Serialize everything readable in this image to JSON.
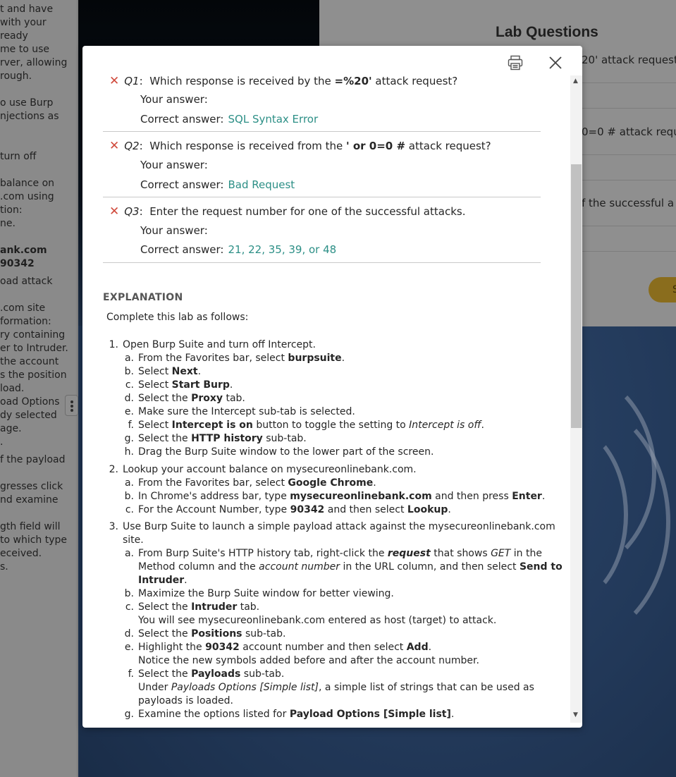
{
  "background": {
    "left_text_lines": [
      "t and have",
      "with your",
      "ready",
      "me to use",
      "rver, allowing",
      "rough.",
      "o use Burp",
      "njections as",
      "turn off",
      "balance on",
      ".com using",
      "tion:",
      "ne.",
      "ank.com",
      "90342",
      "oad attack",
      ".com site",
      "formation:",
      "ry containing",
      "er to Intruder.",
      "the account",
      "s the position",
      "load.",
      "oad Options",
      "dy selected",
      "age.",
      ".",
      "f the payload",
      "gresses click",
      "nd examine",
      "gth field will",
      "to which type",
      "eceived.",
      "s."
    ],
    "lab_panel": {
      "title": "Lab Questions",
      "q_snippets": [
        "20' attack request",
        "0=0 # attack requ",
        "f the successful a"
      ],
      "submit_label": "S"
    },
    "colors": {
      "desktop": "#233a5b",
      "submit": "#8a6d1d"
    }
  },
  "modal": {
    "questions": [
      {
        "marker": "✕",
        "id": "Q1",
        "text_pre": "Which response is received by the ",
        "text_bold": "=%20'",
        "text_post": " attack request?",
        "your_answer_label": "Your answer:",
        "your_answer": "",
        "correct_answer_label": "Correct answer:",
        "correct_answer": "SQL Syntax Error"
      },
      {
        "marker": "✕",
        "id": "Q2",
        "text_pre": "Which response is received from the ",
        "text_bold": "' or 0=0 #",
        "text_post": " attack request?",
        "your_answer_label": "Your answer:",
        "your_answer": "",
        "correct_answer_label": "Correct answer:",
        "correct_answer": "Bad Request"
      },
      {
        "marker": "✕",
        "id": "Q3",
        "text_pre": "Enter the request number for one of the successful attacks.",
        "text_bold": "",
        "text_post": "",
        "your_answer_label": "Your answer:",
        "your_answer": "",
        "correct_answer_label": "Correct answer:",
        "correct_answer": "21, 22, 35, 39, or 48"
      }
    ],
    "explanation": {
      "heading": "EXPLANATION",
      "intro": "Complete this lab as follows:",
      "step1": {
        "num": "1.",
        "text": "Open Burp Suite and turn off Intercept.",
        "a": "From the Favorites bar, select ",
        "a_b": "burpsuite",
        "a_e": ".",
        "b": "Select ",
        "b_b": "Next",
        "b_e": ".",
        "c": "Select ",
        "c_b": "Start Burp",
        "c_e": ".",
        "d": "Select the ",
        "d_b": "Proxy",
        "d_e": " tab.",
        "e": "Make sure the Intercept sub-tab is selected.",
        "f": "Select ",
        "f_b": "Intercept is on",
        "f_m": " button to toggle the setting to ",
        "f_i": "Intercept is off",
        "f_e": ".",
        "g": "Select the ",
        "g_b": "HTTP history",
        "g_e": " sub-tab.",
        "h": "Drag the Burp Suite window to the lower part of the screen."
      },
      "step2": {
        "num": "2.",
        "text": "Lookup your account balance on mysecureonlinebank.com.",
        "a": "From the Favorites bar, select ",
        "a_b": "Google Chrome",
        "a_e": ".",
        "b": "In Chrome's address bar, type ",
        "b_b": "mysecureonlinebank.com",
        "b_m": " and then press ",
        "b_b2": "Enter",
        "b_e": ".",
        "c": "For the Account Number, type ",
        "c_b": "90342",
        "c_m": " and then select ",
        "c_b2": "Lookup",
        "c_e": "."
      },
      "step3": {
        "num": "3.",
        "text_l1": "Use Burp Suite to launch a simple payload attack against the mysecureonlinebank.com",
        "text_l2": "site.",
        "a_l1": "From Burp Suite's HTTP history tab, right-click the ",
        "a_i_b": "request",
        "a_l1_m": " that shows ",
        "a_i": "GET",
        "a_l1_e": " in the",
        "a_l2": "Method column and the ",
        "a_l2_i": "account number",
        "a_l2_m": " in the URL column, and then select ",
        "a_l2_b": "Send to",
        "a_l3_b": "Intruder",
        "a_l3_e": ".",
        "b": "Maximize the Burp Suite window for better viewing.",
        "c": "Select the ",
        "c_b": "Intruder",
        "c_e": " tab.",
        "c_note": "You will see mysecureonlinebank.com entered as host (target) to attack.",
        "d": "Select the ",
        "d_b": "Positions",
        "d_e": " sub-tab.",
        "e": "Highlight the ",
        "e_b": "90342",
        "e_m": " account number and then select ",
        "e_b2": "Add",
        "e_e": ".",
        "e_note": "Notice the new symbols added before and after the account number.",
        "f": "Select the ",
        "f_b": "Payloads",
        "f_e": " sub-tab.",
        "f_note_pre": "Under ",
        "f_note_i": "Payloads Options [Simple list]",
        "f_note_post": ", a simple list of strings that can be used as",
        "f_note_l2": "payloads is loaded.",
        "g": "Examine the options listed for ",
        "g_b": "Payload Options [Simple list]",
        "g_e": "."
      }
    },
    "icons": {
      "print": "printer-icon",
      "close": "close-icon"
    },
    "colors": {
      "correct": "#2c8f86",
      "wrong": "#d04a3c"
    }
  }
}
